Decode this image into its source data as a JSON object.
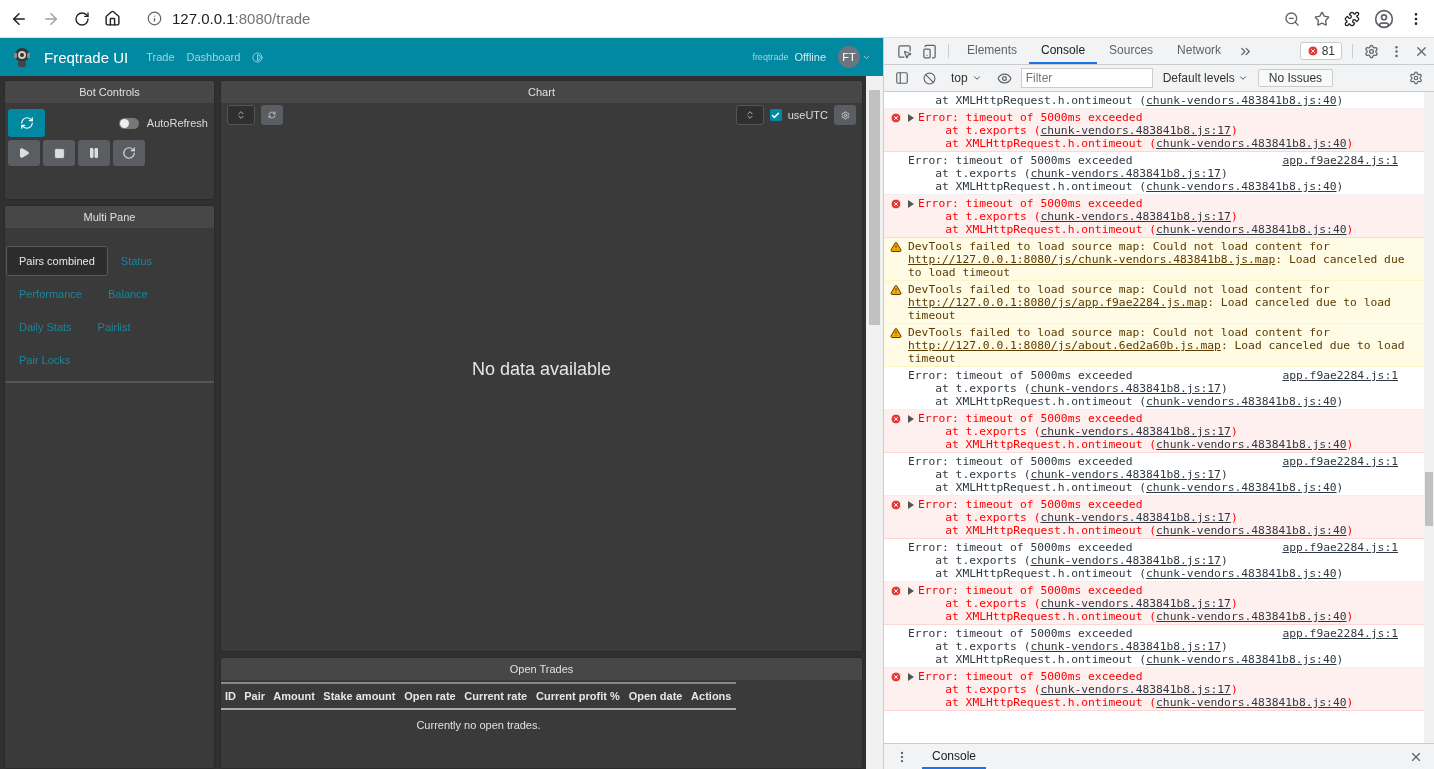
{
  "browser": {
    "url_host": "127.0.0.1",
    "url_rest": ":8080/trade"
  },
  "app": {
    "brand": "Freqtrade UI",
    "nav": [
      {
        "label": "Trade"
      },
      {
        "label": "Dashboard"
      }
    ],
    "bot_name": "freqtrade",
    "status": "Offline",
    "avatar": "FT"
  },
  "bot_controls": {
    "title": "Bot Controls",
    "autorefresh": {
      "label": "AutoRefresh",
      "on": false
    }
  },
  "multi_pane": {
    "title": "Multi Pane",
    "tabs": [
      {
        "label": "Pairs combined",
        "selected": true
      },
      {
        "label": "Status",
        "selected": false
      },
      {
        "label": "Performance",
        "selected": false
      },
      {
        "label": "Balance",
        "selected": false
      },
      {
        "label": "Daily Stats",
        "selected": false
      },
      {
        "label": "Pairlist",
        "selected": false
      },
      {
        "label": "Pair Locks",
        "selected": false
      }
    ]
  },
  "chart": {
    "title": "Chart",
    "use_utc": {
      "label": "useUTC",
      "checked": true
    },
    "empty": "No data available"
  },
  "open_trades": {
    "title": "Open Trades",
    "columns": [
      "ID",
      "Pair",
      "Amount",
      "Stake amount",
      "Open rate",
      "Current rate",
      "Current profit %",
      "Open date",
      "Actions"
    ],
    "empty": "Currently no open trades."
  },
  "devtools": {
    "tabs": [
      {
        "label": "Elements",
        "selected": false
      },
      {
        "label": "Console",
        "selected": true
      },
      {
        "label": "Sources",
        "selected": false
      },
      {
        "label": "Network",
        "selected": false
      }
    ],
    "error_count": "81",
    "context": "top",
    "filter_placeholder": "Filter",
    "levels": "Default levels",
    "issues": "No Issues",
    "drawer_tab": "Console",
    "messages": [
      {
        "kind": "log",
        "lines": [
          {
            "text": "    at XMLHttpRequest.h.ontimeout (",
            "link": "chunk-vendors.483841b8.js:40",
            "after": ")"
          }
        ]
      },
      {
        "kind": "error",
        "lines": [
          {
            "text": "Error: timeout of 5000ms exceeded"
          },
          {
            "text": "    at t.exports (",
            "link": "chunk-vendors.483841b8.js:17",
            "after": ")"
          },
          {
            "text": "    at XMLHttpRequest.h.ontimeout (",
            "link": "chunk-vendors.483841b8.js:40",
            "after": ")"
          }
        ]
      },
      {
        "kind": "log",
        "source": "app.f9ae2284.js:1",
        "lines": [
          {
            "text": "Error: timeout of 5000ms exceeded"
          },
          {
            "text": "    at t.exports (",
            "link": "chunk-vendors.483841b8.js:17",
            "after": ")"
          },
          {
            "text": "    at XMLHttpRequest.h.ontimeout (",
            "link": "chunk-vendors.483841b8.js:40",
            "after": ")"
          }
        ]
      },
      {
        "kind": "error",
        "lines": [
          {
            "text": "Error: timeout of 5000ms exceeded"
          },
          {
            "text": "    at t.exports (",
            "link": "chunk-vendors.483841b8.js:17",
            "after": ")"
          },
          {
            "text": "    at XMLHttpRequest.h.ontimeout (",
            "link": "chunk-vendors.483841b8.js:40",
            "after": ")"
          }
        ]
      },
      {
        "kind": "warning",
        "lines": [
          {
            "text": "DevTools failed to load source map: Could not load content for ",
            "link": "http://127.0.0.1:8080/js/chunk-vendors.483841b8.js.map",
            "after": ": Load canceled due to load timeout"
          }
        ]
      },
      {
        "kind": "warning",
        "lines": [
          {
            "text": "DevTools failed to load source map: Could not load content for ",
            "link": "http://127.0.0.1:8080/js/app.f9ae2284.js.map",
            "after": ": Load canceled due to load timeout"
          }
        ]
      },
      {
        "kind": "warning",
        "lines": [
          {
            "text": "DevTools failed to load source map: Could not load content for ",
            "link": "http://127.0.0.1:8080/js/about.6ed2a60b.js.map",
            "after": ": Load canceled due to load timeout"
          }
        ]
      },
      {
        "kind": "log",
        "source": "app.f9ae2284.js:1",
        "lines": [
          {
            "text": "Error: timeout of 5000ms exceeded"
          },
          {
            "text": "    at t.exports (",
            "link": "chunk-vendors.483841b8.js:17",
            "after": ")"
          },
          {
            "text": "    at XMLHttpRequest.h.ontimeout (",
            "link": "chunk-vendors.483841b8.js:40",
            "after": ")"
          }
        ]
      },
      {
        "kind": "error",
        "lines": [
          {
            "text": "Error: timeout of 5000ms exceeded"
          },
          {
            "text": "    at t.exports (",
            "link": "chunk-vendors.483841b8.js:17",
            "after": ")"
          },
          {
            "text": "    at XMLHttpRequest.h.ontimeout (",
            "link": "chunk-vendors.483841b8.js:40",
            "after": ")"
          }
        ]
      },
      {
        "kind": "log",
        "source": "app.f9ae2284.js:1",
        "lines": [
          {
            "text": "Error: timeout of 5000ms exceeded"
          },
          {
            "text": "    at t.exports (",
            "link": "chunk-vendors.483841b8.js:17",
            "after": ")"
          },
          {
            "text": "    at XMLHttpRequest.h.ontimeout (",
            "link": "chunk-vendors.483841b8.js:40",
            "after": ")"
          }
        ]
      },
      {
        "kind": "error",
        "lines": [
          {
            "text": "Error: timeout of 5000ms exceeded"
          },
          {
            "text": "    at t.exports (",
            "link": "chunk-vendors.483841b8.js:17",
            "after": ")"
          },
          {
            "text": "    at XMLHttpRequest.h.ontimeout (",
            "link": "chunk-vendors.483841b8.js:40",
            "after": ")"
          }
        ]
      },
      {
        "kind": "log",
        "source": "app.f9ae2284.js:1",
        "lines": [
          {
            "text": "Error: timeout of 5000ms exceeded"
          },
          {
            "text": "    at t.exports (",
            "link": "chunk-vendors.483841b8.js:17",
            "after": ")"
          },
          {
            "text": "    at XMLHttpRequest.h.ontimeout (",
            "link": "chunk-vendors.483841b8.js:40",
            "after": ")"
          }
        ]
      },
      {
        "kind": "error",
        "lines": [
          {
            "text": "Error: timeout of 5000ms exceeded"
          },
          {
            "text": "    at t.exports (",
            "link": "chunk-vendors.483841b8.js:17",
            "after": ")"
          },
          {
            "text": "    at XMLHttpRequest.h.ontimeout (",
            "link": "chunk-vendors.483841b8.js:40",
            "after": ")"
          }
        ]
      },
      {
        "kind": "log",
        "source": "app.f9ae2284.js:1",
        "lines": [
          {
            "text": "Error: timeout of 5000ms exceeded"
          },
          {
            "text": "    at t.exports (",
            "link": "chunk-vendors.483841b8.js:17",
            "after": ")"
          },
          {
            "text": "    at XMLHttpRequest.h.ontimeout (",
            "link": "chunk-vendors.483841b8.js:40",
            "after": ")"
          }
        ]
      },
      {
        "kind": "error",
        "lines": [
          {
            "text": "Error: timeout of 5000ms exceeded"
          },
          {
            "text": "    at t.exports (",
            "link": "chunk-vendors.483841b8.js:17",
            "after": ")"
          },
          {
            "text": "    at XMLHttpRequest.h.ontimeout (",
            "link": "chunk-vendors.483841b8.js:40",
            "after": ")"
          }
        ]
      }
    ]
  }
}
